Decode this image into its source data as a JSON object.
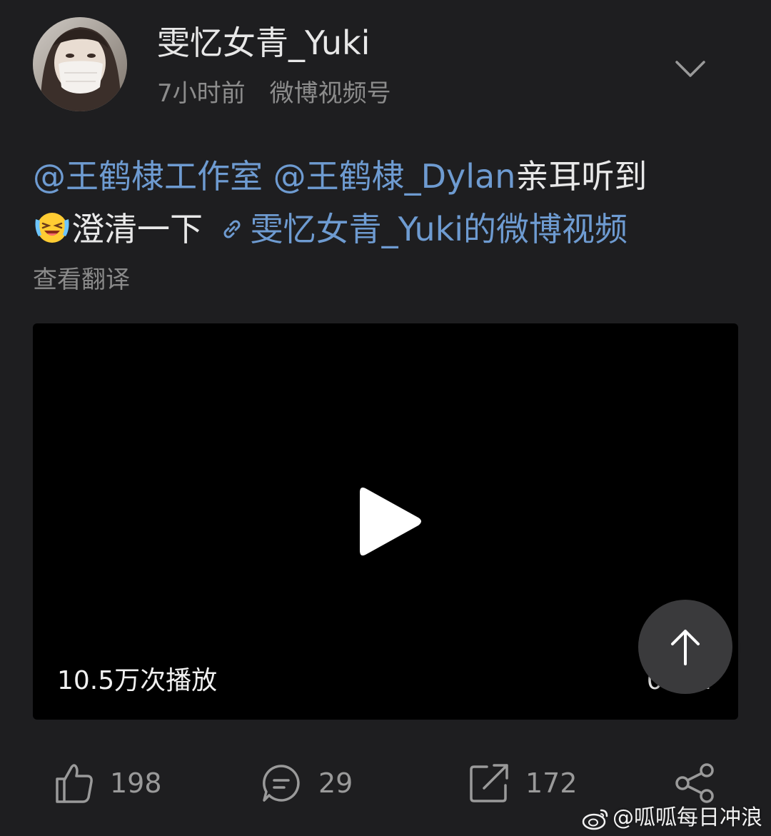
{
  "header": {
    "username": "雯忆女青_Yuki",
    "time": "7小时前",
    "source": "微博视频号",
    "menu_icon": "chevron-down-icon"
  },
  "post": {
    "mention_1": "@王鹤棣工作室",
    "mention_2": "@王鹤棣_Dylan",
    "text_1": "亲耳听到",
    "emoji": "laughing-tears-emoji",
    "text_2": "澄清一下",
    "link_text": "雯忆女青_Yuki的微博视频",
    "translate_label": "查看翻译"
  },
  "video": {
    "play_count": "10.5万次播放",
    "duration": "00:??"
  },
  "actions": {
    "likes": "198",
    "comments": "29",
    "reposts": "172"
  },
  "watermark": {
    "text": "@呱呱每日冲浪"
  },
  "colors": {
    "background": "#1e1e20",
    "link": "#6e9bd1",
    "secondary_text": "#8c8c8c"
  }
}
